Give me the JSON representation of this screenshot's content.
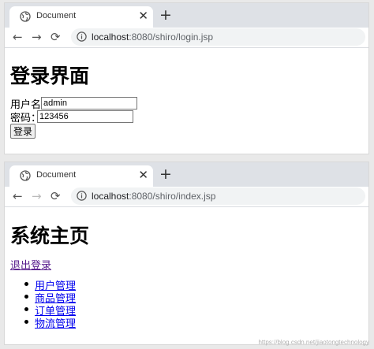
{
  "login_window": {
    "tab_title": "Document",
    "close_glyph": "✕",
    "newtab_glyph": "+",
    "nav": {
      "back": "←",
      "forward": "→",
      "reload": "⟳"
    },
    "url_host": "localhost",
    "url_path": ":8080/shiro/login.jsp",
    "heading": "登录界面",
    "username_label": "用户名:",
    "username_value": "admin",
    "password_label": "密码：",
    "password_value": "123456",
    "submit_label": "登录"
  },
  "index_window": {
    "tab_title": "Document",
    "close_glyph": "✕",
    "newtab_glyph": "+",
    "nav": {
      "back": "←",
      "forward": "→",
      "reload": "⟳"
    },
    "url_host": "localhost",
    "url_path": ":8080/shiro/index.jsp",
    "heading": "系统主页",
    "logout_link": "退出登录",
    "menu": [
      "用户管理",
      "商品管理",
      "订单管理",
      "物流管理"
    ]
  },
  "watermark": "https://blog.csdn.net/jiaotongtechnology",
  "icons": {
    "globe": "globe-icon",
    "info": "info-icon"
  }
}
